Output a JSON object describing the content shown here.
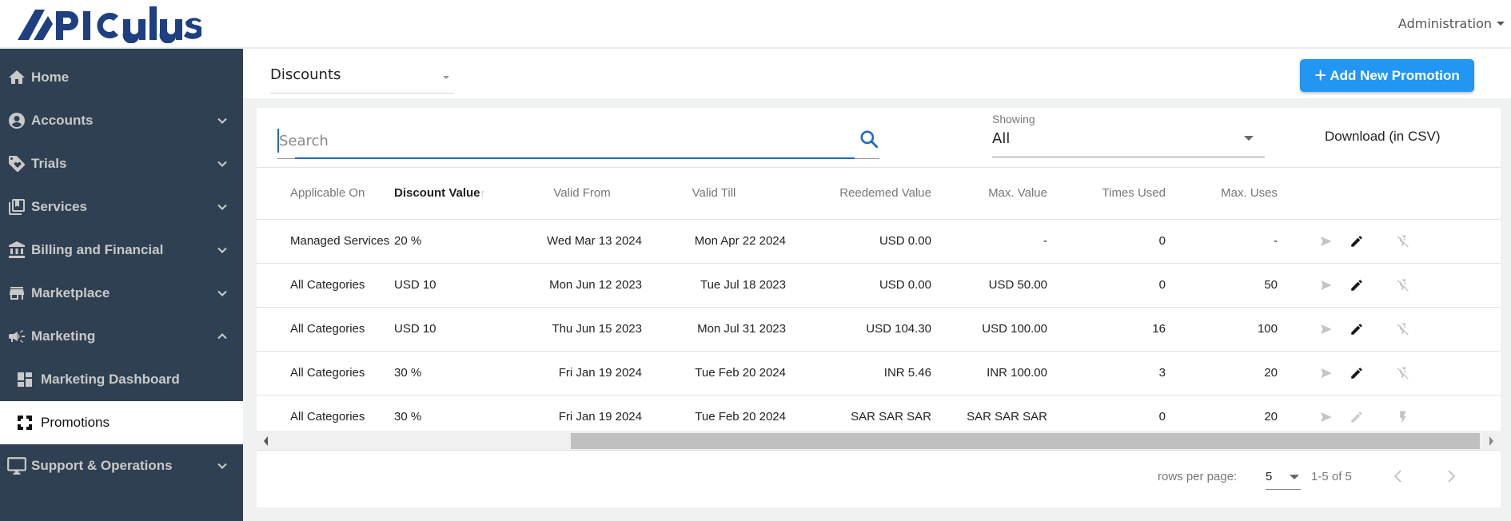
{
  "app": {
    "logo_text": "APICULUS",
    "brand_color": "#1e3f80",
    "admin_menu_label": "Administration"
  },
  "sidebar": {
    "items": [
      {
        "label": "Home",
        "icon": "home-icon",
        "expandable": false
      },
      {
        "label": "Accounts",
        "icon": "account-circle-icon",
        "expandable": true,
        "expanded": false
      },
      {
        "label": "Trials",
        "icon": "tag-heart-icon",
        "expandable": true,
        "expanded": false
      },
      {
        "label": "Services",
        "icon": "library-bookmark-icon",
        "expandable": true,
        "expanded": false
      },
      {
        "label": "Billing and Financial",
        "icon": "bank-icon",
        "expandable": true,
        "expanded": false
      },
      {
        "label": "Marketplace",
        "icon": "store-icon",
        "expandable": true,
        "expanded": false
      },
      {
        "label": "Marketing",
        "icon": "megaphone-icon",
        "expandable": true,
        "expanded": true
      },
      {
        "label": "Marketing Dashboard",
        "icon": "dashboard-icon",
        "sub": true
      },
      {
        "label": "Promotions",
        "icon": "promotions-icon",
        "sub": true,
        "active": true
      },
      {
        "label": "Support & Operations",
        "icon": "monitor-icon",
        "expandable": true,
        "expanded": false
      }
    ]
  },
  "toolbar": {
    "promotion_type": "Discounts",
    "add_button_label": "Add New Promotion",
    "add_button_color": "#2196f3"
  },
  "filters": {
    "search_placeholder": "Search",
    "search_value": "",
    "showing_label": "Showing",
    "showing_value": "All",
    "download_label": "Download (in CSV)"
  },
  "table": {
    "columns": [
      {
        "label": "Applicable On"
      },
      {
        "label": "Discount Value",
        "sorted": "asc"
      },
      {
        "label": "Valid From"
      },
      {
        "label": "Valid Till"
      },
      {
        "label": "Reedemed Value"
      },
      {
        "label": "Max. Value"
      },
      {
        "label": "Times Used"
      },
      {
        "label": "Max. Uses"
      }
    ],
    "sort_arrow": "↑",
    "rows": [
      {
        "applicable_on": "Managed Services",
        "discount_value": "20 %",
        "valid_from": "Wed Mar 13 2024",
        "valid_till": "Mon Apr 22 2024",
        "redeemed_value": "USD 0.00",
        "max_value": "-",
        "times_used": "0",
        "max_uses": "-",
        "edit_enabled": true,
        "toggle_state": "disabled-flash"
      },
      {
        "applicable_on": "All Categories",
        "discount_value": "USD 10",
        "valid_from": "Mon Jun 12 2023",
        "valid_till": "Tue Jul 18 2023",
        "redeemed_value": "USD 0.00",
        "max_value": "USD 50.00",
        "times_used": "0",
        "max_uses": "50",
        "edit_enabled": true,
        "toggle_state": "disabled-flash"
      },
      {
        "applicable_on": "All Categories",
        "discount_value": "USD 10",
        "valid_from": "Thu Jun 15 2023",
        "valid_till": "Mon Jul 31 2023",
        "redeemed_value": "USD 104.30",
        "max_value": "USD 100.00",
        "times_used": "16",
        "max_uses": "100",
        "edit_enabled": true,
        "toggle_state": "disabled-flash"
      },
      {
        "applicable_on": "All Categories",
        "discount_value": "30 %",
        "valid_from": "Fri Jan 19 2024",
        "valid_till": "Tue Feb 20 2024",
        "redeemed_value": "INR 5.46",
        "max_value": "INR 100.00",
        "times_used": "3",
        "max_uses": "20",
        "edit_enabled": true,
        "toggle_state": "disabled-flash"
      },
      {
        "applicable_on": "All Categories",
        "discount_value": "30 %",
        "valid_from": "Fri Jan 19 2024",
        "valid_till": "Tue Feb 20 2024",
        "redeemed_value": "SAR SAR SAR",
        "max_value": "SAR SAR SAR",
        "times_used": "0",
        "max_uses": "20",
        "edit_enabled": false,
        "toggle_state": "flash"
      }
    ]
  },
  "pagination": {
    "rows_per_page_label": "rows per page:",
    "rows_per_page": "5",
    "range_label": "1-5 of 5"
  }
}
